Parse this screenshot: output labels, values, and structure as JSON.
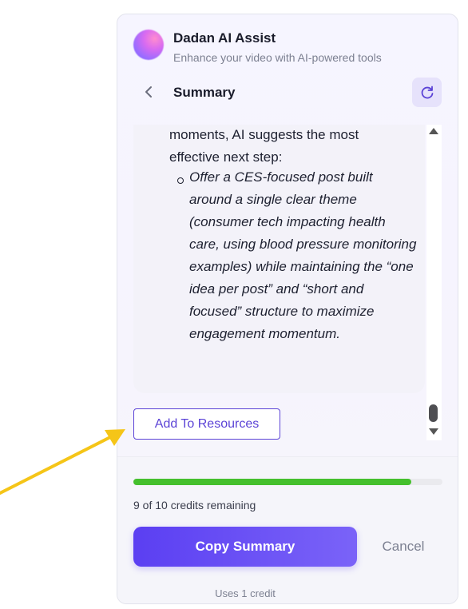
{
  "header": {
    "title": "Dadan AI Assist",
    "subtitle": "Enhance your video with AI-powered tools"
  },
  "nav": {
    "section_title": "Summary"
  },
  "content": {
    "lead_text": "moments, AI suggests the most effective next step:",
    "bullet_text": "Offer a CES-focused post built around a single clear theme (consumer tech impacting health care, using blood pressure monitoring examples) while maintaining the “one idea per post” and “short and focused” structure to maximize engagement momentum."
  },
  "actions": {
    "add_resources_label": "Add To Resources"
  },
  "credits": {
    "remaining_text": "9 of 10 credits remaining",
    "used_fraction": 0.9
  },
  "footer": {
    "copy_label": "Copy Summary",
    "cancel_label": "Cancel",
    "cost_note": "Uses 1 credit"
  },
  "colors": {
    "accent": "#5b3ff2",
    "progress": "#45c02d",
    "annotation_arrow": "#f5c518"
  },
  "icons": [
    "back-chevron-icon",
    "refresh-icon",
    "scroll-up-arrow-icon",
    "scroll-down-arrow-icon"
  ]
}
